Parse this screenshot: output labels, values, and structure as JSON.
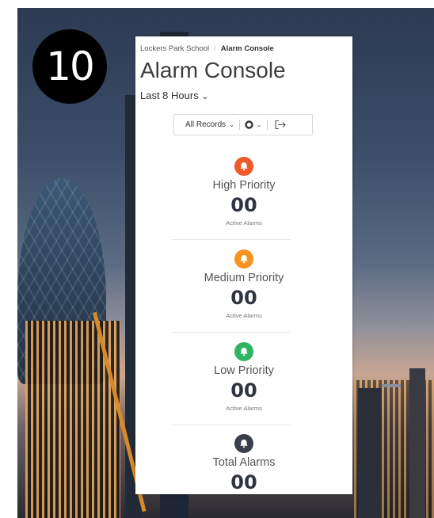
{
  "badge": {
    "number": "10"
  },
  "breadcrumb": {
    "parent": "Lockers Park School",
    "separator": "/",
    "current": "Alarm Console"
  },
  "page": {
    "title": "Alarm Console",
    "time_range": "Last 8 Hours",
    "time_range_chevron": "⌄"
  },
  "toolbar": {
    "filter_label": "All Records",
    "filter_chevron": "⌄",
    "status_chevron": "⌄"
  },
  "sections": [
    {
      "label": "High Priority",
      "count": "00",
      "sub": "Active Alarms",
      "color": "#f05a28"
    },
    {
      "label": "Medium Priority",
      "count": "00",
      "sub": "Active Alarms",
      "color": "#f7931e"
    },
    {
      "label": "Low Priority",
      "count": "00",
      "sub": "Active Alarms",
      "color": "#2db562"
    },
    {
      "label": "Total Alarms",
      "count": "00",
      "color": "#3a3f4b"
    }
  ]
}
